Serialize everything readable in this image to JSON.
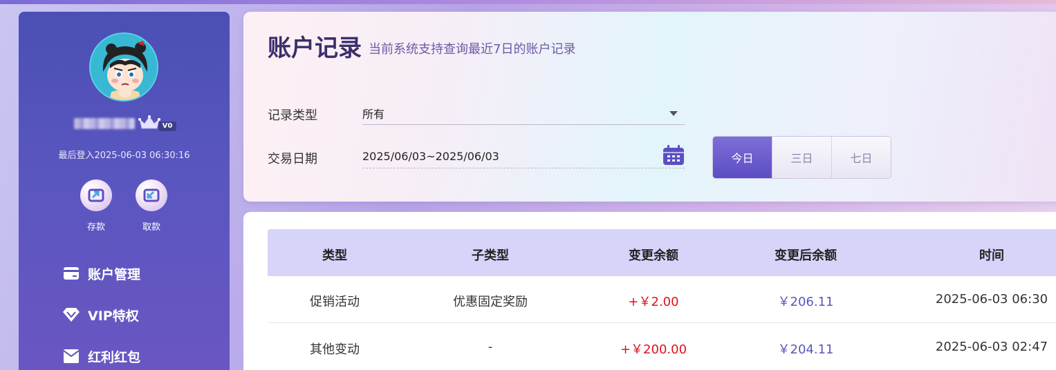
{
  "sidebar": {
    "vip_level": "V0",
    "last_login": "最后登入2025-06-03 06:30:16",
    "actions": [
      {
        "label": "存款",
        "icon": "deposit-icon"
      },
      {
        "label": "取款",
        "icon": "withdraw-icon"
      }
    ],
    "menu": [
      {
        "label": "账户管理",
        "icon": "card-icon"
      },
      {
        "label": "VIP特权",
        "icon": "diamond-icon"
      },
      {
        "label": "红利红包",
        "icon": "envelope-icon"
      }
    ]
  },
  "header": {
    "title": "账户记录",
    "subtitle": "当前系统支持查询最近7日的账户记录"
  },
  "filters": {
    "type_label": "记录类型",
    "type_value": "所有",
    "date_label": "交易日期",
    "date_value": "2025/06/03~2025/06/03",
    "ranges": [
      "今日",
      "三日",
      "七日"
    ],
    "active_range": "今日"
  },
  "table": {
    "columns": [
      "类型",
      "子类型",
      "变更余额",
      "变更后余额",
      "时间"
    ],
    "rows": [
      [
        "促销活动",
        "优惠固定奖励",
        "+￥2.00",
        "￥206.11",
        "2025-06-03 06:30"
      ],
      [
        "其他变动",
        "-",
        "+￥200.00",
        "￥204.11",
        "2025-06-03 02:47"
      ]
    ]
  },
  "colors": {
    "sidebar": "#5552bc",
    "accent": "#6b5cd0",
    "positive": "#e0101a",
    "balance": "#5b56b8",
    "table_header": "#d6d4f9"
  }
}
